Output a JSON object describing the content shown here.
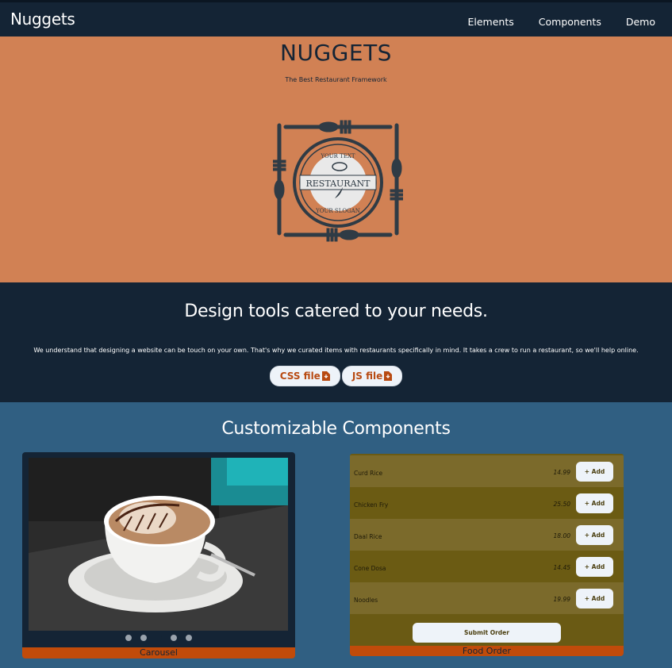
{
  "navbar": {
    "brand": "Nuggets",
    "links": [
      "Elements",
      "Components",
      "Demo"
    ]
  },
  "hero": {
    "title": "NUGGETS",
    "subtitle": "The Best Restaurant Framework",
    "logo": {
      "top_text": "YOUR TEXT",
      "main_text": "RESTAURANT",
      "bottom_text": "YOUR SLOGAN"
    }
  },
  "tools": {
    "title": "Design tools catered to your needs.",
    "text": "We understand that designing a website can be touch on your own. That's why we curated items with restaurants specifically in mind. It takes a crew to run a restaurant, so we'll help online.",
    "css_button": "CSS file",
    "js_button": "JS file",
    "button_icon": "download-file-icon"
  },
  "components": {
    "title": "Customizable Components",
    "carousel": {
      "label": "Carousel",
      "image": "coffee-cup-photo",
      "dots": 5,
      "active_dot": 2
    },
    "food_order": {
      "label": "Food Order",
      "add_label": "+ Add",
      "submit_label": "Submit Order",
      "items": [
        {
          "name": "Curd Rice",
          "price": "14.99"
        },
        {
          "name": "Chicken Fry",
          "price": "25.50"
        },
        {
          "name": "Daal Rice",
          "price": "18.00"
        },
        {
          "name": "Cone Dosa",
          "price": "14.45"
        },
        {
          "name": "Noodles",
          "price": "19.99"
        }
      ]
    }
  },
  "colors": {
    "navy": "#142435",
    "orange": "#d18154",
    "blue": "#305f82",
    "olive": "#6a5a14",
    "accent": "#c14b0a"
  }
}
